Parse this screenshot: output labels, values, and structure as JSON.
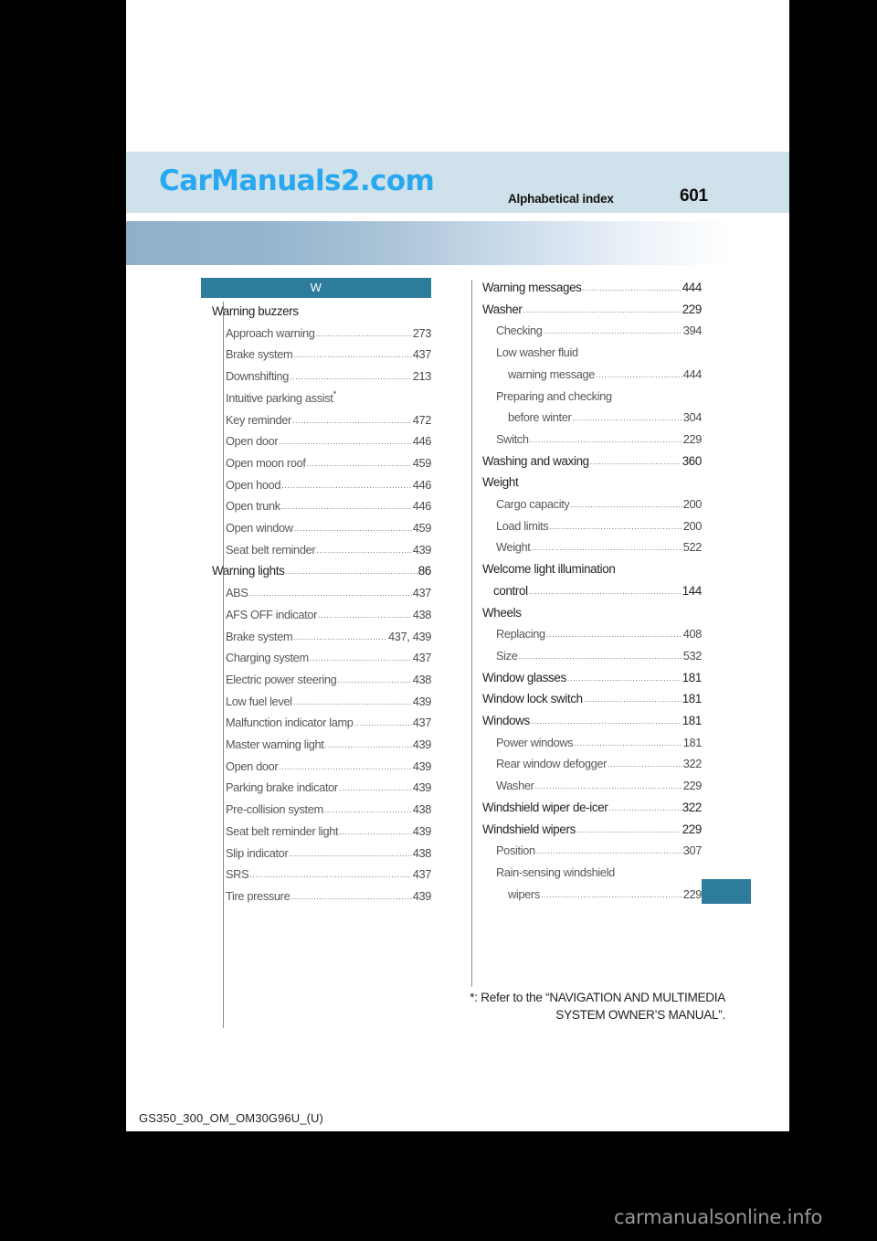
{
  "header": {
    "watermark_logo": "CarManuals2.com",
    "title": "Alphabetical index",
    "page_number": "601"
  },
  "index": {
    "letter": "W",
    "left_column": [
      {
        "level": 1,
        "label": "Warning buzzers",
        "page": "",
        "dots": false
      },
      {
        "level": 2,
        "label": "Approach warning",
        "page": "273",
        "dots": true
      },
      {
        "level": 2,
        "label": "Brake system",
        "page": "437",
        "dots": true
      },
      {
        "level": 2,
        "label": "Downshifting",
        "page": "213",
        "dots": true
      },
      {
        "level": 2,
        "label": "Intuitive parking assist*",
        "page": "",
        "dots": false
      },
      {
        "level": 2,
        "label": "Key reminder",
        "page": "472",
        "dots": true
      },
      {
        "level": 2,
        "label": "Open door",
        "page": "446",
        "dots": true
      },
      {
        "level": 2,
        "label": "Open moon roof",
        "page": "459",
        "dots": true
      },
      {
        "level": 2,
        "label": "Open hood",
        "page": "446",
        "dots": true
      },
      {
        "level": 2,
        "label": "Open trunk",
        "page": "446",
        "dots": true
      },
      {
        "level": 2,
        "label": "Open window",
        "page": "459",
        "dots": true
      },
      {
        "level": 2,
        "label": "Seat belt reminder",
        "page": "439",
        "dots": true
      },
      {
        "level": 1,
        "label": "Warning lights",
        "page": "86",
        "dots": true
      },
      {
        "level": 2,
        "label": "ABS",
        "page": "437",
        "dots": true
      },
      {
        "level": 2,
        "label": "AFS OFF indicator",
        "page": "438",
        "dots": true
      },
      {
        "level": 2,
        "label": "Brake system",
        "page": "437, 439",
        "dots": true
      },
      {
        "level": 2,
        "label": "Charging system",
        "page": "437",
        "dots": true
      },
      {
        "level": 2,
        "label": "Electric power steering",
        "page": "438",
        "dots": true
      },
      {
        "level": 2,
        "label": "Low fuel level",
        "page": "439",
        "dots": true
      },
      {
        "level": 2,
        "label": "Malfunction indicator lamp",
        "page": "437",
        "dots": true
      },
      {
        "level": 2,
        "label": "Master warning light",
        "page": "439",
        "dots": true
      },
      {
        "level": 2,
        "label": "Open door",
        "page": "439",
        "dots": true
      },
      {
        "level": 2,
        "label": "Parking brake indicator",
        "page": "439",
        "dots": true
      },
      {
        "level": 2,
        "label": "Pre-collision system",
        "page": "438",
        "dots": true
      },
      {
        "level": 2,
        "label": "Seat belt reminder light",
        "page": "439",
        "dots": true
      },
      {
        "level": 2,
        "label": "Slip indicator",
        "page": "438",
        "dots": true
      },
      {
        "level": 2,
        "label": "SRS",
        "page": "437",
        "dots": true
      },
      {
        "level": 2,
        "label": "Tire pressure",
        "page": "439",
        "dots": true
      }
    ],
    "right_column": [
      {
        "level": 1,
        "label": "Warning messages",
        "page": "444",
        "dots": true
      },
      {
        "level": 1,
        "label": "Washer",
        "page": "229",
        "dots": true
      },
      {
        "level": 2,
        "label": "Checking",
        "page": "394",
        "dots": true
      },
      {
        "level": 2,
        "label": "Low washer fluid",
        "page": "",
        "dots": false
      },
      {
        "level": 3,
        "label": "warning message",
        "page": "444",
        "dots": true
      },
      {
        "level": 2,
        "label": "Preparing and checking",
        "page": "",
        "dots": false
      },
      {
        "level": 3,
        "label": "before winter",
        "page": "304",
        "dots": true
      },
      {
        "level": 2,
        "label": "Switch",
        "page": "229",
        "dots": true
      },
      {
        "level": 1,
        "label": "Washing and waxing",
        "page": "360",
        "dots": true
      },
      {
        "level": 1,
        "label": "Weight",
        "page": "",
        "dots": false
      },
      {
        "level": 2,
        "label": "Cargo capacity",
        "page": "200",
        "dots": true
      },
      {
        "level": 2,
        "label": "Load limits",
        "page": "200",
        "dots": true
      },
      {
        "level": 2,
        "label": "Weight",
        "page": "522",
        "dots": true
      },
      {
        "level": 1,
        "label": "Welcome light illumination",
        "page": "",
        "dots": false
      },
      {
        "level": 4,
        "label": "control",
        "page": "144",
        "dots": true
      },
      {
        "level": 1,
        "label": "Wheels",
        "page": "",
        "dots": false
      },
      {
        "level": 2,
        "label": "Replacing",
        "page": "408",
        "dots": true
      },
      {
        "level": 2,
        "label": "Size",
        "page": "532",
        "dots": true
      },
      {
        "level": 1,
        "label": "Window glasses",
        "page": "181",
        "dots": true
      },
      {
        "level": 1,
        "label": "Window lock switch",
        "page": "181",
        "dots": true
      },
      {
        "level": 1,
        "label": "Windows",
        "page": "181",
        "dots": true
      },
      {
        "level": 2,
        "label": "Power windows",
        "page": "181",
        "dots": true
      },
      {
        "level": 2,
        "label": "Rear window defogger",
        "page": "322",
        "dots": true
      },
      {
        "level": 2,
        "label": "Washer",
        "page": "229",
        "dots": true
      },
      {
        "level": 1,
        "label": "Windshield wiper de-icer",
        "page": "322",
        "dots": true
      },
      {
        "level": 1,
        "label": "Windshield wipers",
        "page": "229",
        "dots": true
      },
      {
        "level": 2,
        "label": "Position",
        "page": "307",
        "dots": true
      },
      {
        "level": 2,
        "label": "Rain-sensing windshield",
        "page": "",
        "dots": false
      },
      {
        "level": 3,
        "label": "wipers",
        "page": "229",
        "dots": true
      }
    ]
  },
  "footnote": {
    "line1": "*: Refer to the “NAVIGATION AND MULTIMEDIA",
    "line2": "SYSTEM OWNER’S MANUAL”."
  },
  "footer": {
    "document_code": "GS350_300_OM_OM30G96U_(U)"
  },
  "site_watermark": "carmanualsonline.info",
  "colors": {
    "accent_teal": "#2e7c9b",
    "header_band": "#cfe1ea",
    "logo_blue": "#29a8f0",
    "gradient_start": "#8fb0cb"
  }
}
